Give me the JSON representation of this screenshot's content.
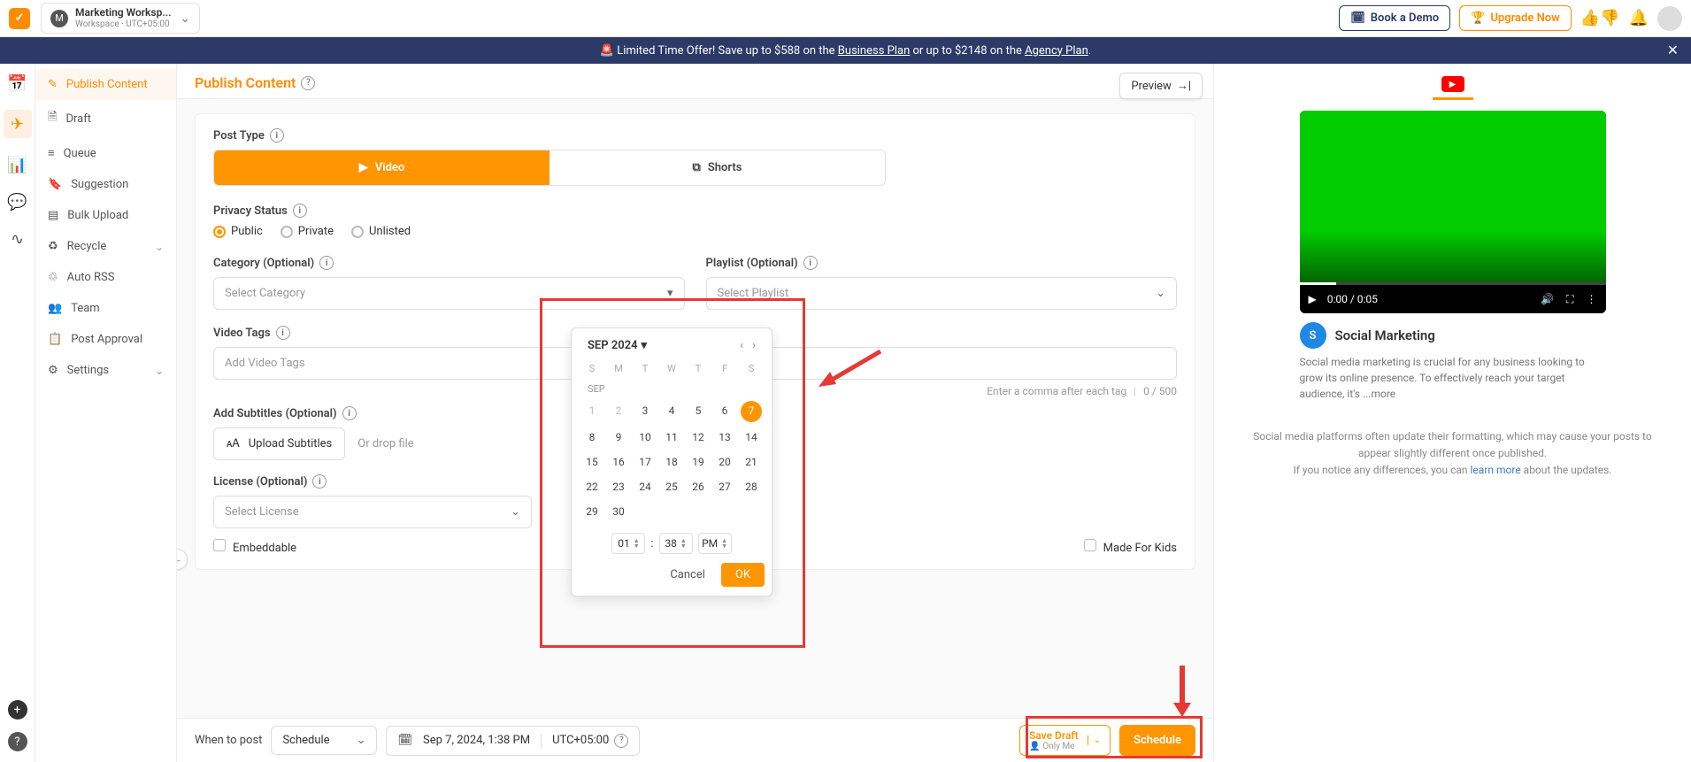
{
  "topbar": {
    "workspace_badge": "M",
    "workspace_name": "Marketing Worksp...",
    "workspace_sub": "Workspace · UTC+05:00",
    "book_demo": "Book a Demo",
    "upgrade": "Upgrade Now"
  },
  "banner": {
    "text_prefix": "🚨 Limited Time Offer! Save up to $588 on the ",
    "link1": "Business Plan",
    "text_mid": " or up to $2148 on the ",
    "link2": "Agency Plan",
    "text_suffix": "."
  },
  "sidebar": {
    "items": [
      {
        "label": "Publish Content",
        "active": true
      },
      {
        "label": "Draft"
      },
      {
        "label": "Queue"
      },
      {
        "label": "Suggestion"
      },
      {
        "label": "Bulk Upload"
      },
      {
        "label": "Recycle",
        "expandable": true
      },
      {
        "label": "Auto RSS"
      },
      {
        "label": "Team"
      },
      {
        "label": "Post Approval"
      },
      {
        "label": "Settings",
        "expandable": true
      }
    ]
  },
  "page": {
    "title": "Publish Content",
    "preview_label": "Preview"
  },
  "form": {
    "post_type_label": "Post Type",
    "video_label": "Video",
    "shorts_label": "Shorts",
    "privacy_label": "Privacy Status",
    "public": "Public",
    "private": "Private",
    "unlisted": "Unlisted",
    "category_label": "Category (Optional)",
    "category_placeholder": "Select Category",
    "playlist_label": "Playlist (Optional)",
    "playlist_placeholder": "Select Playlist",
    "tags_label": "Video Tags",
    "tags_placeholder": "Add Video Tags",
    "tags_hint": "Enter a comma after each tag",
    "tags_count": "0 / 500",
    "subtitles_label": "Add Subtitles (Optional)",
    "upload_subtitles": "Upload Subtitles",
    "drop_hint": "Or drop file",
    "license_label": "License (Optional)",
    "license_placeholder": "Select License",
    "embeddable": "Embeddable",
    "made_for_kids": "Made For Kids"
  },
  "calendar": {
    "title": "SEP 2024",
    "month_label": "SEP",
    "dows": [
      "S",
      "M",
      "T",
      "W",
      "T",
      "F",
      "S"
    ],
    "rows": [
      [
        "1",
        "2",
        "3",
        "4",
        "5",
        "6",
        "7"
      ],
      [
        "8",
        "9",
        "10",
        "11",
        "12",
        "13",
        "14"
      ],
      [
        "15",
        "16",
        "17",
        "18",
        "19",
        "20",
        "21"
      ],
      [
        "22",
        "23",
        "24",
        "25",
        "26",
        "27",
        "28"
      ],
      [
        "29",
        "30",
        "",
        "",
        "",
        "",
        ""
      ]
    ],
    "selected": "7",
    "hour": "01",
    "minute": "38",
    "ampm": "PM",
    "cancel": "Cancel",
    "ok": "OK"
  },
  "footer": {
    "when_label": "When to post",
    "schedule_mode": "Schedule",
    "date_display": "Sep 7, 2024, 1:38 PM",
    "tz": "UTC+05:00",
    "save_draft": "Save Draft",
    "only_me": "Only Me",
    "schedule_btn": "Schedule"
  },
  "preview": {
    "time": "0:00 / 0:05",
    "channel_initial": "S",
    "channel_name": "Social Marketing",
    "description": "Social media marketing is crucial for any business looking to grow its online presence. To effectively reach your target audience, it's ",
    "more": "...more",
    "disclaimer_1": "Social media platforms often update their formatting, which may cause your posts to appear slightly different once published.",
    "disclaimer_2a": "If you notice any differences, you can ",
    "disclaimer_link": "learn more",
    "disclaimer_2b": " about the updates."
  }
}
